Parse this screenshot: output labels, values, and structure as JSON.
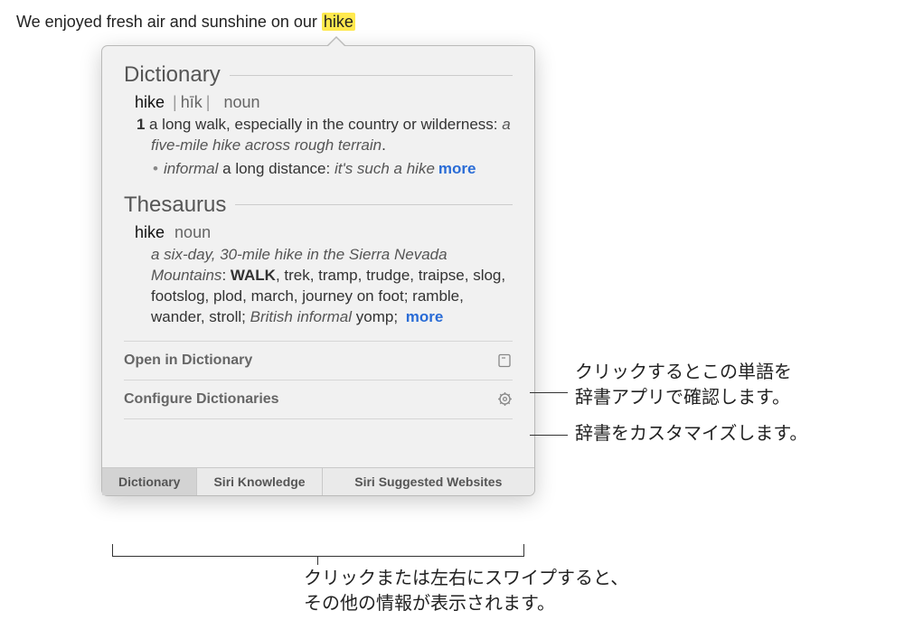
{
  "sentence": {
    "prefix": "We enjoyed fresh air and sunshine on our ",
    "highlighted": "hike"
  },
  "dictionary": {
    "heading": "Dictionary",
    "word": "hike",
    "pronunciation": "hīk",
    "pos": "noun",
    "def_num": "1",
    "definition": "a long walk, especially in the country or wilderness: ",
    "example": "a five-mile hike across rough terrain",
    "period": ".",
    "sub_tag": "informal",
    "sub_def": " a long distance: ",
    "sub_example": "it's such a hike",
    "more": "more"
  },
  "thesaurus": {
    "heading": "Thesaurus",
    "word": "hike",
    "pos": "noun",
    "example": "a six-day, 30-mile hike in the Sierra Nevada Mountains",
    "colon": ": ",
    "primary": "WALK",
    "synonyms": ", trek, tramp, trudge, traipse, slog, footslog, plod, march, journey on foot; ramble, wander, stroll; ",
    "brit_tag": "British informal",
    "brit_word": " yomp; ",
    "more": "more"
  },
  "actions": {
    "open": "Open in Dictionary",
    "configure": "Configure Dictionaries"
  },
  "tabs": {
    "dictionary": "Dictionary",
    "siri_knowledge": "Siri Knowledge",
    "siri_websites": "Siri Suggested Websites"
  },
  "annotations": {
    "open_help": "クリックするとこの単語を\n辞書アプリで確認します。",
    "configure_help": "辞書をカスタマイズします。",
    "tabs_help": "クリックまたは左右にスワイプすると、\nその他の情報が表示されます。"
  }
}
